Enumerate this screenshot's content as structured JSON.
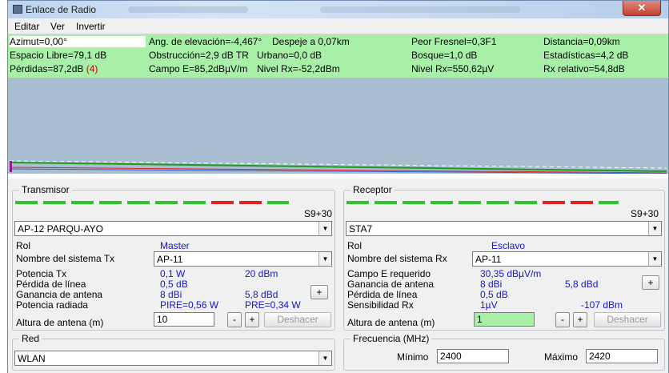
{
  "window": {
    "title": "Enlace de Radio",
    "close_glyph": "✕"
  },
  "menu": [
    "Editar",
    "Ver",
    "Invertir"
  ],
  "info": {
    "row1": [
      "Azimut=0,00°",
      "Ang. de elevación=-4,467°",
      "Despeje a 0,07km",
      "Peor Fresnel=0,3F1",
      "Distancia=0,09km"
    ],
    "row2": [
      "Espacio Libre=79,1 dB",
      "Obstrucción=2,9 dB TR",
      "Urbano=0,0 dB",
      "Bosque=1,0 dB",
      "Estadísticas=4,2 dB"
    ],
    "row3_loss": "Pérdidas=87,2dB",
    "row3_loss_count": "(4)",
    "row3": [
      "Campo E=85,2dBµV/m",
      "Nivel Rx=-52,2dBm",
      "Nivel Rx=550,62µV",
      "Rx relativo=54,8dB"
    ]
  },
  "transmitter": {
    "group_label": "Transmisor",
    "signal": "S9+30",
    "station": "AP-12 PARQU-AYO",
    "role_label": "Rol",
    "role": "Master",
    "system_label": "Nombre del sistema Tx",
    "system": "AP-11",
    "power_label": "Potencia Tx",
    "power_w": "0,1 W",
    "power_dbm": "20 dBm",
    "line_loss_label": "Pérdida de línea",
    "line_loss": "0,5 dB",
    "gain_label": "Ganancia de antena",
    "gain_dbi": "8 dBi",
    "gain_dbd": "5,8 dBd",
    "radiated_label": "Potencia radiada",
    "pire": "PIRE=0,56 W",
    "pre": "PRE=0,34 W",
    "height_label": "Altura de antena (m)",
    "height": "10",
    "minus": "-",
    "plus": "+",
    "undo": "Deshacer"
  },
  "receiver": {
    "group_label": "Receptor",
    "signal": "S9+30",
    "station": "STA7",
    "role_label": "Rol",
    "role": "Esclavo",
    "system_label": "Nombre del sistema Rx",
    "system": "AP-11",
    "field_label": "Campo E requerido",
    "field_value": "30,35 dBµV/m",
    "gain_label": "Ganancia de antena",
    "gain_dbi": "8 dBi",
    "gain_dbd": "5,8 dBd",
    "line_loss_label": "Pérdida de línea",
    "line_loss": "0,5 dB",
    "sensitivity_label": "Sensibilidad Rx",
    "sensitivity_uv": "1µV",
    "sensitivity_dbm": "-107 dBm",
    "height_label": "Altura de antena (m)",
    "height": "1",
    "minus": "-",
    "plus": "+",
    "undo": "Deshacer"
  },
  "network": {
    "group_label": "Red",
    "value": "WLAN"
  },
  "frequency": {
    "group_label": "Frecuencia (MHz)",
    "min_label": "Mínimo",
    "min": "2400",
    "max_label": "Máximo",
    "max": "2420"
  },
  "colors": {
    "info_bg": "#a8f0a8",
    "profile_bg": "#a9bed0",
    "meter_green": "#2ec42e",
    "meter_red": "#e02424",
    "link_value": "#1515d6"
  },
  "icons": {
    "dropdown": "▼",
    "app": "radio-link-icon"
  }
}
